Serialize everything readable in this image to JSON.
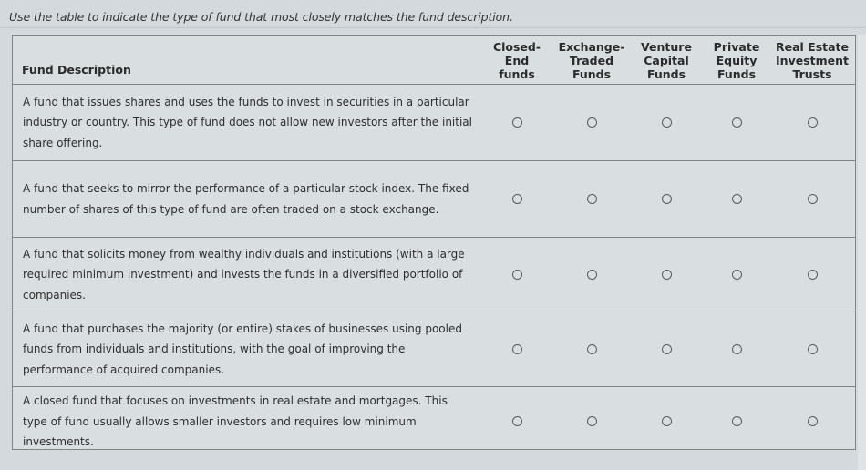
{
  "instruction": "Use the table to indicate the type of fund that most closely matches the fund description.",
  "table": {
    "description_header": "Fund Description",
    "columns": [
      {
        "line1": "Closed-",
        "line2": "End",
        "line3": "funds"
      },
      {
        "line1": "Exchange-",
        "line2": "Traded",
        "line3": "Funds"
      },
      {
        "line1": "Venture",
        "line2": "Capital",
        "line3": "Funds"
      },
      {
        "line1": "Private",
        "line2": "Equity",
        "line3": "Funds"
      },
      {
        "line1": "Real Estate",
        "line2": "Investment",
        "line3": "Trusts"
      }
    ],
    "rows": [
      {
        "description": "A fund that issues shares and uses the funds to invest in securities in a particular industry or country. This type of fund does not allow new investors after the initial share offering.",
        "selected": null
      },
      {
        "description": "A fund that seeks to mirror the performance of a particular stock index. The fixed number of shares of this type of fund are often traded on a stock exchange.",
        "selected": null
      },
      {
        "description": "A fund that solicits money from wealthy individuals and institutions (with a large required minimum investment) and invests the funds in a diversified portfolio of companies.",
        "selected": null
      },
      {
        "description": "A fund that purchases the majority (or entire) stakes of businesses using pooled funds from individuals and institutions, with the goal of improving the performance of acquired companies.",
        "selected": null
      },
      {
        "description": "A closed fund that focuses on investments in real estate and mortgages. This type of fund usually allows smaller investors and requires low minimum investments.",
        "selected": null
      }
    ]
  }
}
